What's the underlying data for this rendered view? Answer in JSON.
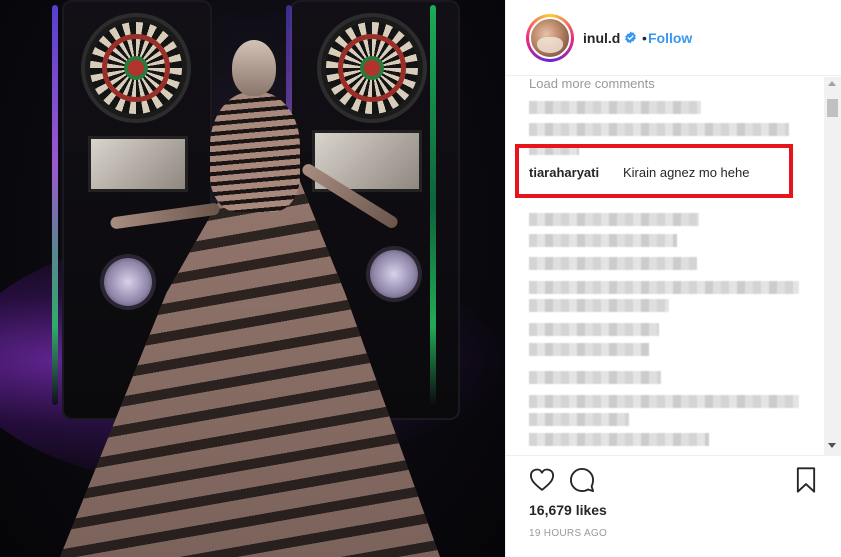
{
  "post": {
    "image_alt": ""
  },
  "header": {
    "username": "inul.d",
    "verified_icon": "verified-badge-icon",
    "separator": "•",
    "follow_label": "Follow"
  },
  "comments": {
    "load_more_label": "Load more comments",
    "highlighted": {
      "username": "tiaraharyati",
      "text": "Kirain agnez mo hehe"
    },
    "highlight_color": "#e8141b"
  },
  "actions": {
    "like_icon": "heart-icon",
    "comment_icon": "comment-bubble-icon",
    "save_icon": "bookmark-icon",
    "likes_label": "16,679 likes",
    "timestamp": "19 HOURS AGO"
  },
  "colors": {
    "link": "#3897f0",
    "text": "#262626",
    "muted": "#999999",
    "border": "#efefef"
  }
}
